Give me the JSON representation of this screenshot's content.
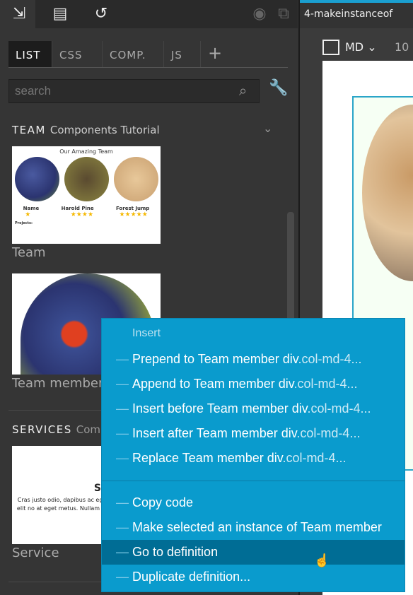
{
  "toolbar": {
    "icons": [
      "import-icon",
      "library-icon",
      "undo-icon",
      "eye-icon",
      "duplicate-icon"
    ]
  },
  "tabs": [
    {
      "label": "LIST"
    },
    {
      "label": "CSS"
    },
    {
      "label": "COMP."
    },
    {
      "label": "JS"
    }
  ],
  "tab_add": "+",
  "search": {
    "placeholder": "search"
  },
  "library": {
    "team_section": {
      "name": "TEAM",
      "subtitle": "Components Tutorial"
    },
    "team_thumb": {
      "title": "Our Amazing Team",
      "members": [
        {
          "name": "Name",
          "stars": 1
        },
        {
          "name": "Harold Pine",
          "stars": 4
        },
        {
          "name": "Forest Jump",
          "stars": 5
        }
      ],
      "projects_label": "Projects:"
    },
    "items": [
      "Team",
      "Team member"
    ],
    "services_section": {
      "name": "SERVICES",
      "subtitle": "Comp"
    },
    "service_thumb": {
      "title": "Service",
      "text": "Cras justo odio, dapibus ac eget quam. Donec id elit no at eget metus. Nullam id do vehicula ut id"
    },
    "service_label": "Service"
  },
  "editor": {
    "tab_title": "4-makeinstanceof",
    "device": "MD",
    "zoom": "10"
  },
  "context_menu": {
    "header": "Insert",
    "insert_items": [
      {
        "pre": "Prepend to Team member div",
        "dim": ".col-md-4..."
      },
      {
        "pre": "Append to Team member div",
        "dim": ".col-md-4..."
      },
      {
        "pre": "Insert before Team member div",
        "dim": ".col-md-4..."
      },
      {
        "pre": "Insert after Team member div",
        "dim": ".col-md-4..."
      },
      {
        "pre": "Replace Team member div",
        "dim": ".col-md-4..."
      }
    ],
    "other_items": [
      "Copy code",
      "Make selected an instance of Team member",
      "Go to definition",
      "Duplicate definition..."
    ],
    "highlighted": "Go to definition"
  }
}
